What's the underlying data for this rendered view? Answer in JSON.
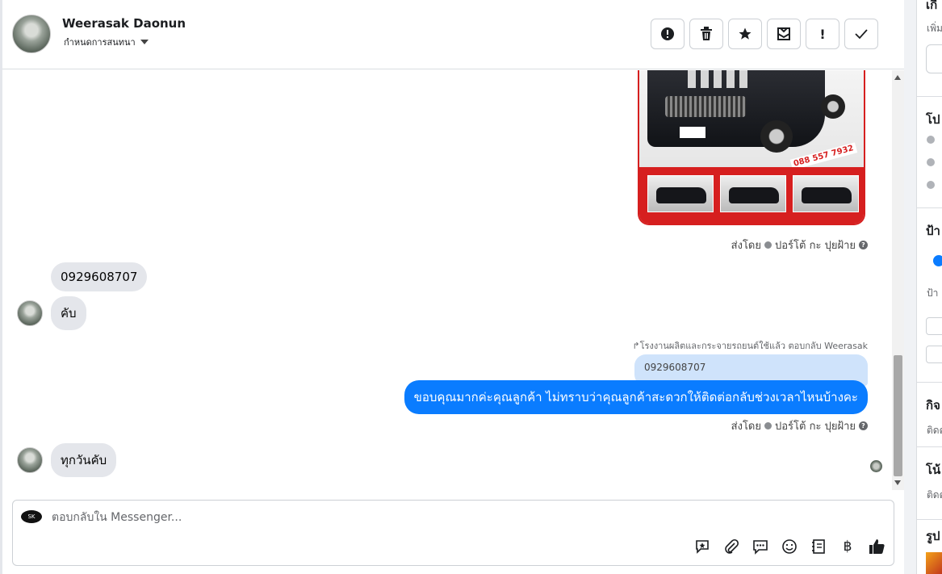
{
  "header": {
    "name": "Weerasak Daonun",
    "subtitle": "กำหนดการสนทนา"
  },
  "toolbar": {
    "items": [
      {
        "name": "alert-circle-icon",
        "glyph": "●"
      },
      {
        "name": "trash-icon",
        "glyph": "🗑"
      },
      {
        "name": "star-icon",
        "glyph": "★"
      },
      {
        "name": "mail-open-icon",
        "glyph": "✉"
      },
      {
        "name": "exclamation-icon",
        "glyph": "!"
      },
      {
        "name": "check-icon",
        "glyph": "✓"
      }
    ]
  },
  "image_message": {
    "phone_tag": "088 557 7932"
  },
  "messages": {
    "sent_by_label": "ส่งโดย",
    "sent_by_name": "ปอร์โต้ กะ ปุยฝ้าย",
    "in_phone": "0929608707",
    "in_reply1": "คับ",
    "reply_meta": "โรงงานผลิตและกระจายรถยนต์ใช้แล้ว ตอบกลับ Weerasak",
    "quoted": "0929608707",
    "out_text": "ขอบคุณมากค่ะคุณลูกค้า ไม่ทราบว่าคุณลูกค้าสะดวกให้ติดต่อกลับช่วงเวลาไหนบ้างคะ",
    "in_reply2": "ทุกวันคับ"
  },
  "composer": {
    "placeholder": "ตอบกลับใน Messenger...",
    "tools": [
      {
        "name": "sticker-reply-icon",
        "glyph": "✎"
      },
      {
        "name": "attachment-icon",
        "glyph": "⌀"
      },
      {
        "name": "saved-replies-icon",
        "glyph": "…"
      },
      {
        "name": "emoji-icon",
        "glyph": "☺"
      },
      {
        "name": "catalog-icon",
        "glyph": "▤"
      },
      {
        "name": "baht-icon",
        "glyph": "฿"
      },
      {
        "name": "thumbs-up-icon",
        "glyph": "👍"
      }
    ]
  },
  "side": {
    "s1_title": "เกี",
    "s1_text": "เพิ่ม",
    "s2_title": "โป",
    "s3_title": "ป้า",
    "s3_text": "ป้า",
    "s4_title": "กิจ",
    "s4_text": "ติดต",
    "s5_title": "โน้",
    "s5_text": "ติดต",
    "s6_title": "รูป"
  },
  "colors": {
    "accent": "#0a7cff",
    "bubble_in": "#e4e6eb",
    "quoted": "#cfe3fb"
  }
}
